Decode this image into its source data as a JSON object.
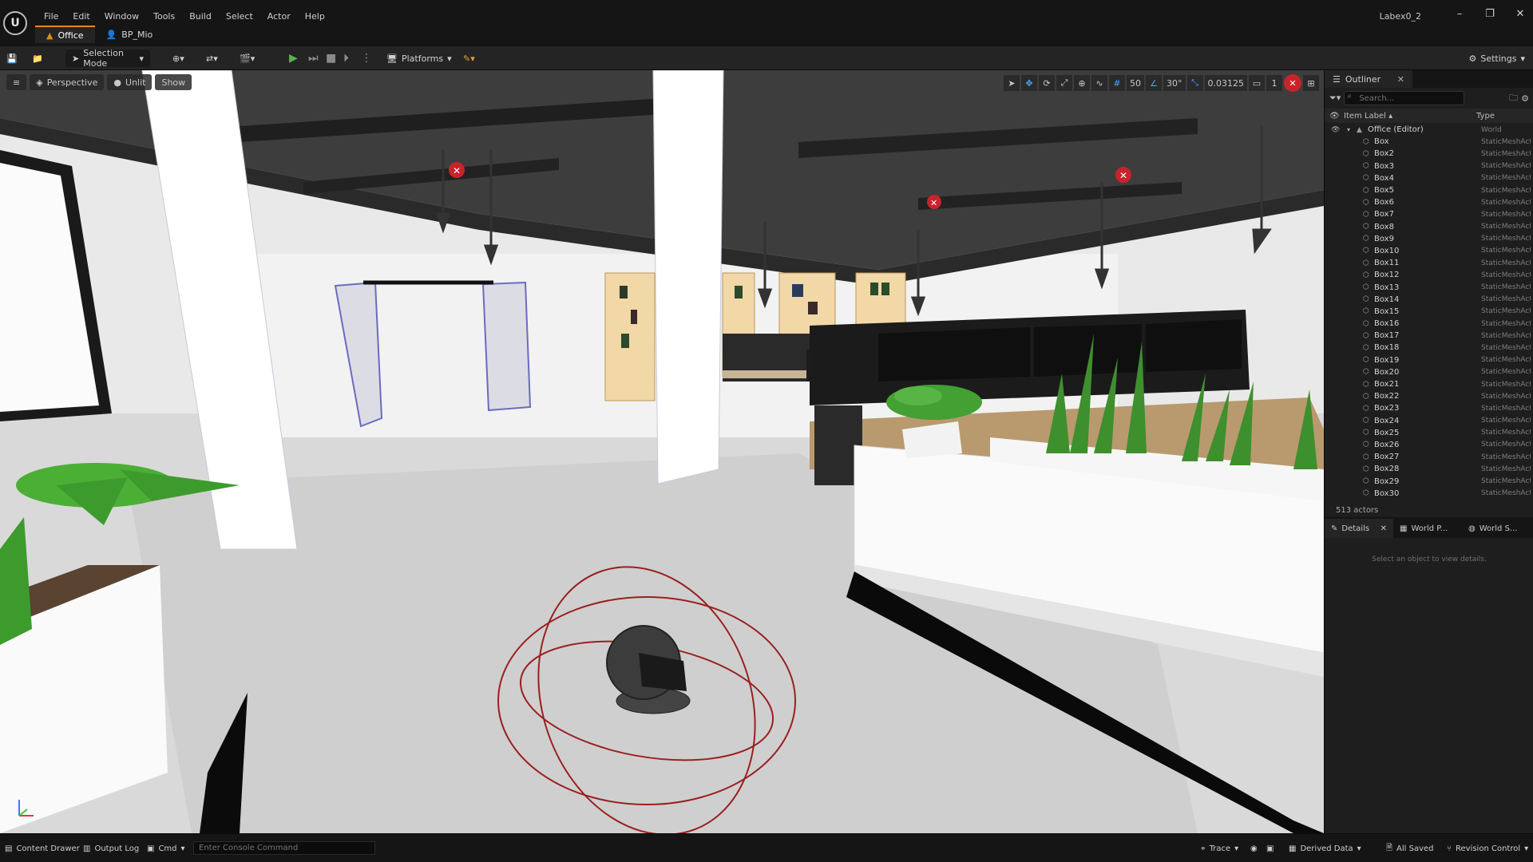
{
  "menu": [
    "File",
    "Edit",
    "Window",
    "Tools",
    "Build",
    "Select",
    "Actor",
    "Help"
  ],
  "doc_tabs": [
    {
      "label": "Office",
      "icon": "level-icon",
      "active": true
    },
    {
      "label": "BP_Mio",
      "icon": "blueprint-icon",
      "active": false
    }
  ],
  "project_name": "Labex0_2",
  "toolbar": {
    "selection_mode": "Selection Mode",
    "platforms": "Platforms",
    "settings": "Settings"
  },
  "viewport": {
    "perspective": "Perspective",
    "unlit": "Unlit",
    "show": "Show",
    "grid_snap": "50",
    "rotation_snap": "30°",
    "scale_snap": "0.03125",
    "camera_speed": "1"
  },
  "outliner": {
    "tab_label": "Outliner",
    "search_placeholder": "Search...",
    "col_label": "Item Label",
    "col_type": "Type",
    "root": {
      "name": "Office (Editor)",
      "type": "World"
    },
    "items": [
      {
        "name": "Box",
        "type": "StaticMeshActor"
      },
      {
        "name": "Box2",
        "type": "StaticMeshActor"
      },
      {
        "name": "Box3",
        "type": "StaticMeshActor"
      },
      {
        "name": "Box4",
        "type": "StaticMeshActor"
      },
      {
        "name": "Box5",
        "type": "StaticMeshActor"
      },
      {
        "name": "Box6",
        "type": "StaticMeshActor"
      },
      {
        "name": "Box7",
        "type": "StaticMeshActor"
      },
      {
        "name": "Box8",
        "type": "StaticMeshActor"
      },
      {
        "name": "Box9",
        "type": "StaticMeshActor"
      },
      {
        "name": "Box10",
        "type": "StaticMeshActor"
      },
      {
        "name": "Box11",
        "type": "StaticMeshActor"
      },
      {
        "name": "Box12",
        "type": "StaticMeshActor"
      },
      {
        "name": "Box13",
        "type": "StaticMeshActor"
      },
      {
        "name": "Box14",
        "type": "StaticMeshActor"
      },
      {
        "name": "Box15",
        "type": "StaticMeshActor"
      },
      {
        "name": "Box16",
        "type": "StaticMeshActor"
      },
      {
        "name": "Box17",
        "type": "StaticMeshActor"
      },
      {
        "name": "Box18",
        "type": "StaticMeshActor"
      },
      {
        "name": "Box19",
        "type": "StaticMeshActor"
      },
      {
        "name": "Box20",
        "type": "StaticMeshActor"
      },
      {
        "name": "Box21",
        "type": "StaticMeshActor"
      },
      {
        "name": "Box22",
        "type": "StaticMeshActor"
      },
      {
        "name": "Box23",
        "type": "StaticMeshActor"
      },
      {
        "name": "Box24",
        "type": "StaticMeshActor"
      },
      {
        "name": "Box25",
        "type": "StaticMeshActor"
      },
      {
        "name": "Box26",
        "type": "StaticMeshActor"
      },
      {
        "name": "Box27",
        "type": "StaticMeshActor"
      },
      {
        "name": "Box28",
        "type": "StaticMeshActor"
      },
      {
        "name": "Box29",
        "type": "StaticMeshActor"
      },
      {
        "name": "Box30",
        "type": "StaticMeshActor"
      }
    ],
    "actor_count": "513 actors"
  },
  "details": {
    "tabs": [
      "Details",
      "World P...",
      "World S..."
    ],
    "empty_text": "Select an object to view details."
  },
  "statusbar": {
    "content_drawer": "Content Drawer",
    "output_log": "Output Log",
    "cmd": "Cmd",
    "console_placeholder": "Enter Console Command",
    "trace": "Trace",
    "derived_data": "Derived Data",
    "all_saved": "All Saved",
    "revision_control": "Revision Control"
  },
  "colors": {
    "accent": "#e08a1e",
    "play": "#58b34a",
    "snap_blue": "#4aa3ff",
    "error_red": "#c8232b"
  }
}
